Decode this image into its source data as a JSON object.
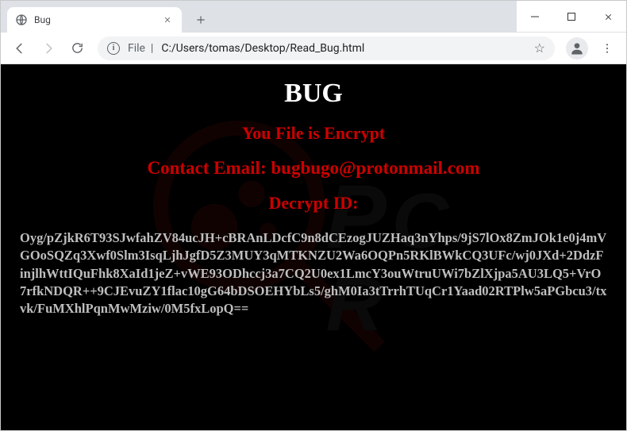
{
  "window": {
    "tab_title": "Bug"
  },
  "addr": {
    "proto": "File",
    "full_path": "C:/Users/tomas/Desktop/Read_Bug.html"
  },
  "page": {
    "title": "BUG",
    "subtitle": "You File is Encrypt",
    "contact_label": "Contact Email: ",
    "contact_email": "bugbugo@protonmail.com",
    "decrypt_label": "Decrypt ID:",
    "cipher": "Oyg/pZjkR6T93SJwfahZV84ucJH+cBRAnLDcfC9n8dCEzogJUZHaq3nYhps/9jS7lOx8ZmJOk1e0j4mVGOoSQZq3Xwf0Slm3IsqLjhJgfD5Z3MUY3qMTKNZU2Wa6OQPn5RKlBWkCQ3UFc/wj0JXd+2DdzFinjlhWttIQuFhk8XaId1jeZ+vWE93ODhccj3a7CQ2U0ex1LmcY3ouWtruUWi7bZlXjpa5AU3LQ5+VrO7rfkNDQR++9CJEvuZY1flac10gG64bDSOEHYbLs5/ghM0Ia3tTrrhTUqCr1Yaad02RTPlw5aPGbcu3/txvk/FuMXhlPqnMwMziw/0M5fxLopQ=="
  },
  "icons": {
    "globe": "globe-icon",
    "close": "close-icon",
    "plus": "plus-icon",
    "minimize": "minimize-icon",
    "maximize": "maximize-icon",
    "back": "arrow-left-icon",
    "forward": "arrow-right-icon",
    "reload": "reload-icon",
    "info": "info-icon",
    "star": "star-icon",
    "avatar": "avatar-icon",
    "menu": "menu-dots-icon"
  },
  "colors": {
    "accent_red": "#cc0000",
    "bg_page": "#000000",
    "cipher_text": "#bfbfbf"
  }
}
